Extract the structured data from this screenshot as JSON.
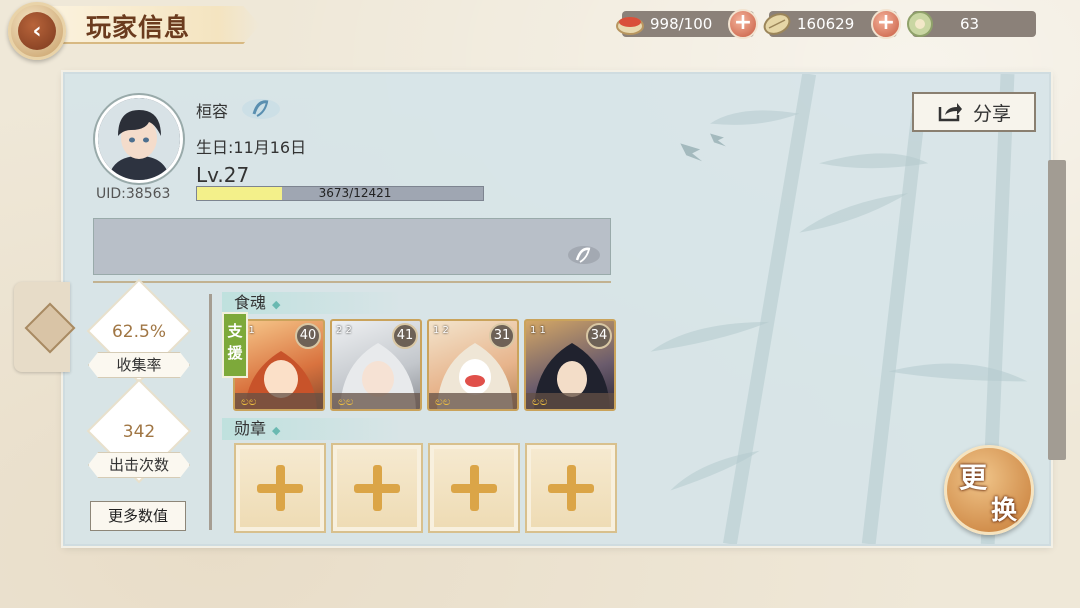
{
  "header": {
    "title": "玩家信息"
  },
  "resources": [
    {
      "name": "food",
      "value": "998/100",
      "icon": "bowl-icon"
    },
    {
      "name": "coins",
      "value": "160629",
      "icon": "coin-icon"
    },
    {
      "name": "jade",
      "value": "63",
      "icon": "jade-icon"
    }
  ],
  "player": {
    "name": "桓容",
    "birthday": "生日:11月16日",
    "level": "Lv.27",
    "exp_text": "3673/12421",
    "exp_fraction": 0.2955,
    "uid": "UID:38563"
  },
  "stats": [
    {
      "value": "62.5%",
      "label": "收集率"
    },
    {
      "value": "342",
      "label": "出击次数"
    }
  ],
  "more_button": "更多数值",
  "share_button": "分享",
  "sections": {
    "souls": "食魂",
    "medals": "勋章"
  },
  "support_tag": "支援",
  "cards": [
    {
      "level": "40",
      "pips": "1 1",
      "stars": 2,
      "palette": "orange"
    },
    {
      "level": "41",
      "pips": "2 2",
      "stars": 2,
      "palette": "white"
    },
    {
      "level": "31",
      "pips": "1 2",
      "stars": 2,
      "palette": "mask"
    },
    {
      "level": "34",
      "pips": "1 1",
      "stars": 2,
      "palette": "dark"
    }
  ],
  "change_button": {
    "top": "更",
    "bottom": "换"
  }
}
